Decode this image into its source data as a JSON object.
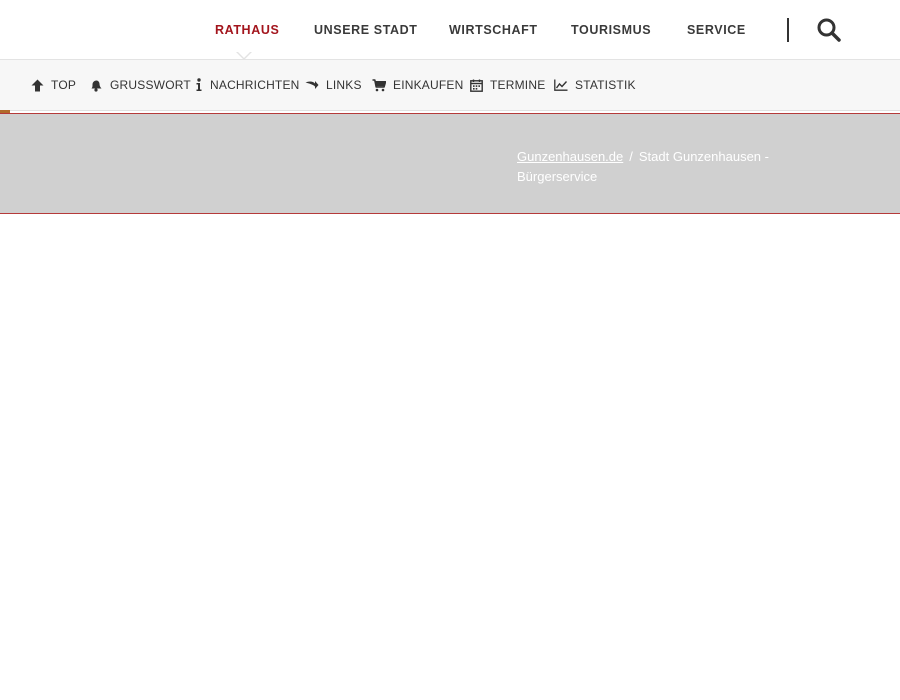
{
  "colors": {
    "accent": "#a3151d",
    "nav_text": "#3a3a3a",
    "subbar_bg": "#f7f7f7",
    "band_bg": "#d0d0d0",
    "band_border": "#b53a3a"
  },
  "topnav": {
    "items": [
      {
        "label": "RATHAUS",
        "active": true
      },
      {
        "label": "UNSERE STADT"
      },
      {
        "label": "WIRTSCHAFT"
      },
      {
        "label": "TOURISMUS"
      },
      {
        "label": "SERVICE"
      }
    ],
    "search_icon": "search-icon"
  },
  "subbar": {
    "items": [
      {
        "label": "TOP",
        "icon": "arrow-up-icon"
      },
      {
        "label": "GRUSSWORT",
        "icon": "bell-icon"
      },
      {
        "label": "NACHRICHTEN",
        "icon": "info-icon"
      },
      {
        "label": "LINKS",
        "icon": "share-arrow-icon"
      },
      {
        "label": "EINKAUFEN",
        "icon": "shopping-cart-icon"
      },
      {
        "label": "TERMINE",
        "icon": "calendar-icon"
      },
      {
        "label": "STATISTIK",
        "icon": "line-chart-icon"
      }
    ]
  },
  "breadcrumb": {
    "home": "Gunzenhausen.de",
    "separator": "/",
    "current": "Stadt Gunzenhausen - Bürgerservice"
  }
}
